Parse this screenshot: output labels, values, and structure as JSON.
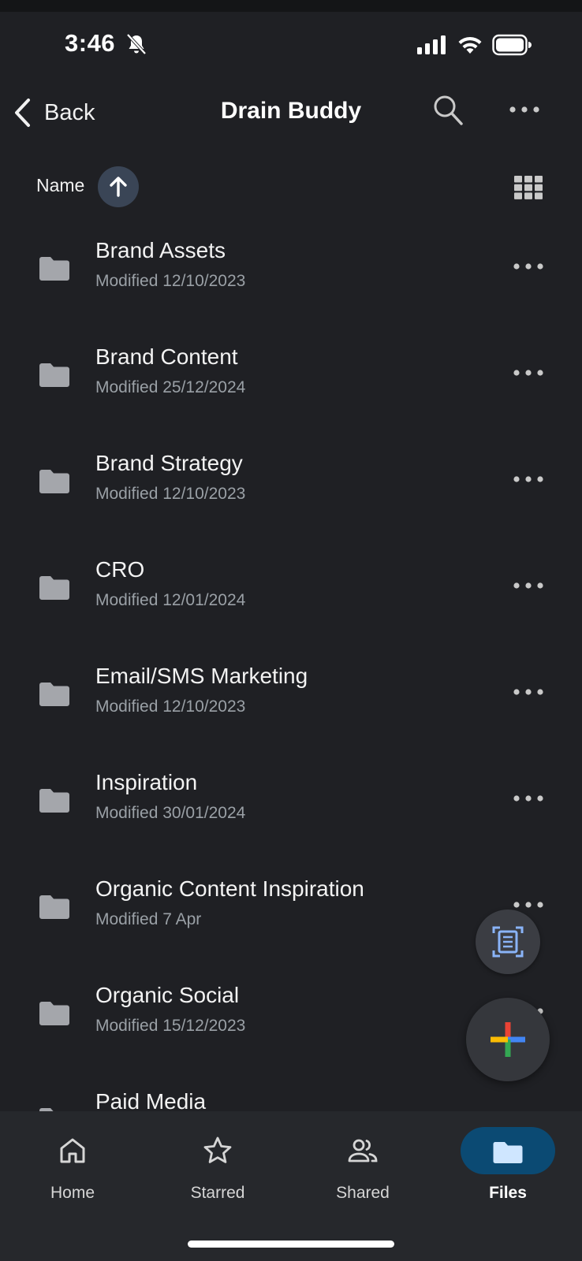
{
  "status": {
    "time": "3:46"
  },
  "header": {
    "back_label": "Back",
    "title": "Drain Buddy"
  },
  "sort": {
    "label": "Name"
  },
  "folders": [
    {
      "name": "Brand Assets",
      "modified": "Modified 12/10/2023"
    },
    {
      "name": "Brand Content",
      "modified": "Modified 25/12/2024"
    },
    {
      "name": "Brand Strategy",
      "modified": "Modified 12/10/2023"
    },
    {
      "name": "CRO",
      "modified": "Modified 12/01/2024"
    },
    {
      "name": "Email/SMS Marketing",
      "modified": "Modified 12/10/2023"
    },
    {
      "name": "Inspiration",
      "modified": "Modified 30/01/2024"
    },
    {
      "name": "Organic Content Inspiration",
      "modified": "Modified 7 Apr"
    },
    {
      "name": "Organic Social",
      "modified": "Modified 15/12/2023"
    },
    {
      "name": "Paid Media",
      "modified": ""
    }
  ],
  "nav": {
    "items": [
      {
        "label": "Home",
        "icon": "home-icon"
      },
      {
        "label": "Starred",
        "icon": "star-icon"
      },
      {
        "label": "Shared",
        "icon": "people-icon"
      },
      {
        "label": "Files",
        "icon": "folder-icon",
        "active": true
      }
    ]
  },
  "colors": {
    "background": "#1f2024",
    "nav_background": "#26282c",
    "active_pill": "#0b4a73",
    "sort_button": "#3a4556",
    "folder_icon": "#a4a6ab",
    "secondary_text": "#9aa0a6"
  }
}
